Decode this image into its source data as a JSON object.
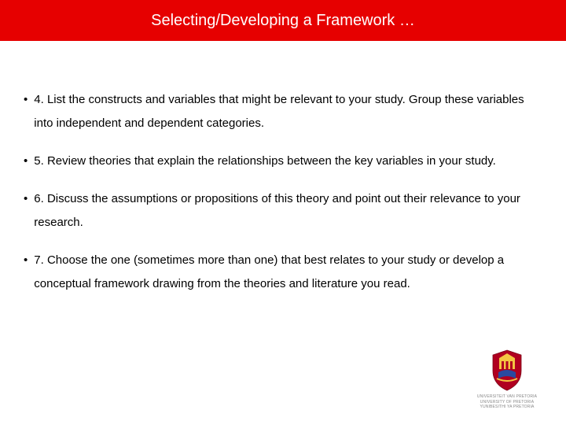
{
  "header": {
    "title": "Selecting/Developing a Framework …"
  },
  "bullets": [
    {
      "text": "4.   List  the constructs and variables that might be relevant to your study. Group these variables into independent and dependent categories."
    },
    {
      "text": "5.   Review theories that explain the relationships between the key variables in your study."
    },
    {
      "text": "6.   Discuss the assumptions or propositions of this theory and point out their relevance to your research."
    },
    {
      "text": "7.   Choose the one (sometimes more than one) that best relates to your study or develop a conceptual framework drawing from the theories and literature you read."
    }
  ],
  "logo": {
    "line1": "UNIVERSITEIT VAN PRETORIA",
    "line2": "UNIVERSITY OF PRETORIA",
    "line3": "YUNIBESITHI YA PRETORIA"
  }
}
